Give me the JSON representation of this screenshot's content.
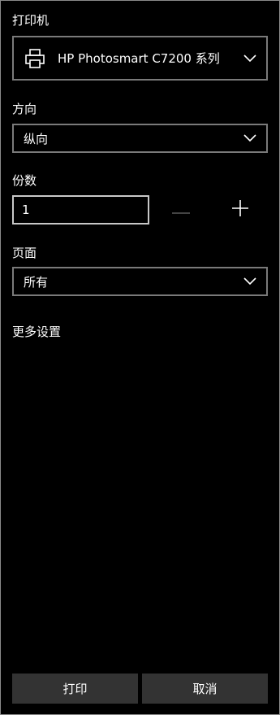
{
  "printer": {
    "label": "打印机",
    "selected": "HP Photosmart C7200 系列",
    "icon": "printer-icon"
  },
  "orientation": {
    "label": "方向",
    "selected": "纵向"
  },
  "copies": {
    "label": "份数",
    "value": "1",
    "decrement_icon": "minus-icon",
    "increment_icon": "plus-icon"
  },
  "pages": {
    "label": "页面",
    "selected": "所有"
  },
  "more_settings": "更多设置",
  "actions": {
    "print": "打印",
    "cancel": "取消"
  },
  "colors": {
    "background": "#000000",
    "border": "#7a7a7a",
    "button": "#333333",
    "disabled_icon": "#5a5a5a"
  }
}
